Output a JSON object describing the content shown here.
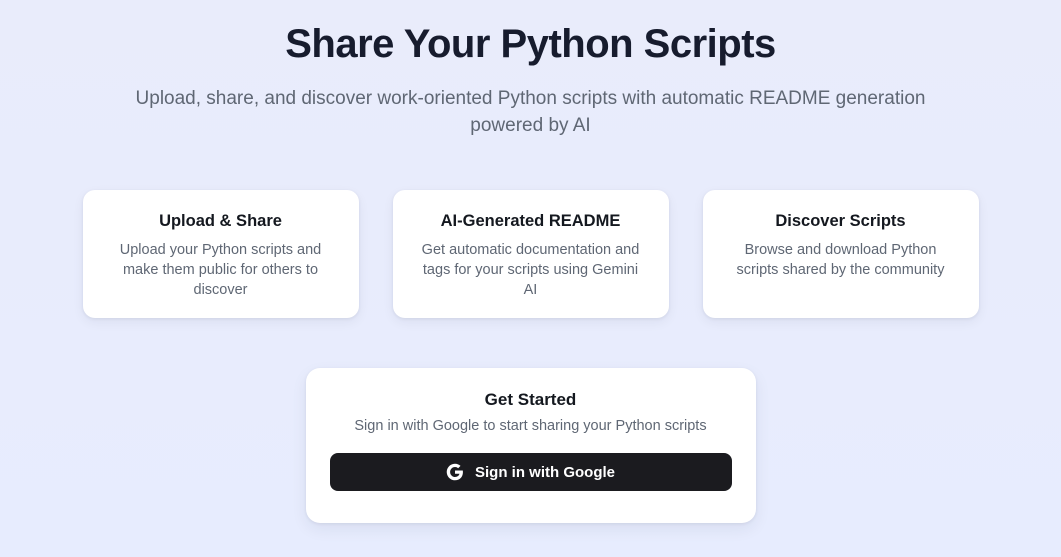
{
  "page": {
    "title": "Share Your Python Scripts",
    "subtitle": "Upload, share, and discover work-oriented Python scripts with automatic README generation powered by AI"
  },
  "features": [
    {
      "title": "Upload & Share",
      "description": "Upload your Python scripts and make them public for others to discover"
    },
    {
      "title": "AI-Generated README",
      "description": "Get automatic documentation and tags for your scripts using Gemini AI"
    },
    {
      "title": "Discover Scripts",
      "description": "Browse and download Python scripts shared by the community"
    }
  ],
  "get_started": {
    "title": "Get Started",
    "subtitle": "Sign in with Google to start sharing your Python scripts",
    "button_label": "Sign in with Google",
    "button_icon": "google-g-icon"
  },
  "colors": {
    "background": "#e8ecfc",
    "card_background": "#ffffff",
    "heading_text": "#171c2e",
    "body_text": "#5f6774",
    "button_background": "#1b1b1f",
    "button_text": "#ffffff"
  }
}
